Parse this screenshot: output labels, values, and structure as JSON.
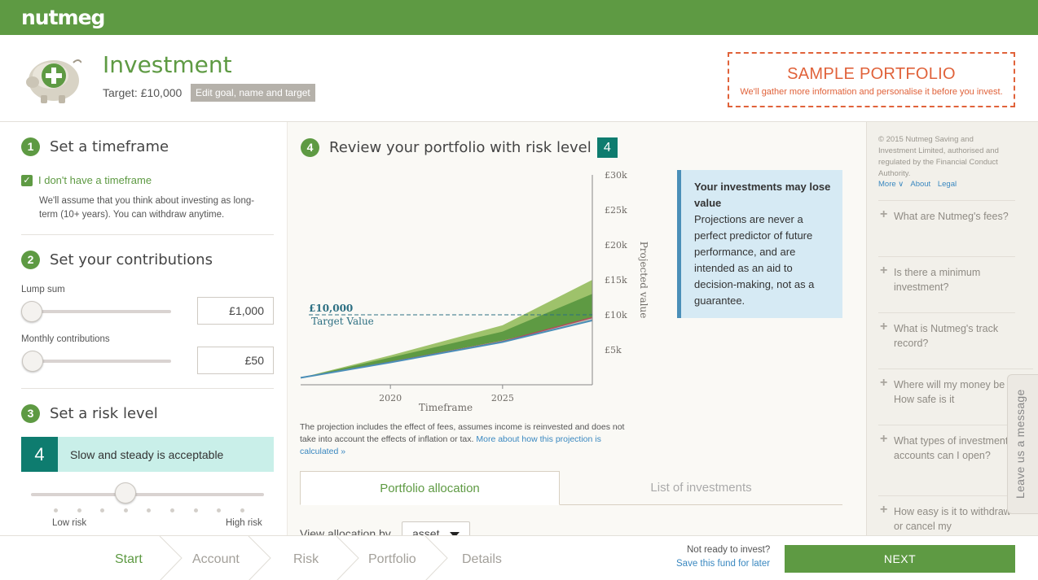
{
  "brand": {
    "logo": "nutmeg",
    "primary": "#5e9a43",
    "accent": "#0e7c6f",
    "warning": "#e0623a"
  },
  "header": {
    "title": "Investment",
    "target": "Target: £10,000",
    "edit_goal": "Edit goal, name and target",
    "sample_title": "SAMPLE PORTFOLIO",
    "sample_sub": "We'll gather more information and personalise it before you invest."
  },
  "steps": {
    "timeframe": {
      "num": "1",
      "title": "Set a timeframe",
      "checkbox_label": "I don't have a timeframe",
      "checked": true,
      "note": "We'll assume that you think about investing as long-term (10+ years). You can withdraw anytime."
    },
    "contributions": {
      "num": "2",
      "title": "Set your contributions",
      "lump_label": "Lump sum",
      "lump_value": "£1,000",
      "monthly_label": "Monthly contributions",
      "monthly_value": "£50"
    },
    "risk": {
      "num": "3",
      "title": "Set a risk level",
      "level": "4",
      "description": "Slow and steady is acceptable",
      "low": "Low risk",
      "high": "High risk",
      "level_index": 4,
      "level_count": 10
    }
  },
  "review": {
    "num": "4",
    "title": "Review your portfolio with risk level",
    "risk_level": "4",
    "warning_title": "Your investments may lose value",
    "warning_body": "Projections are never a perfect predictor of future performance, and are intended as an aid to decision-making, not as a guarantee.",
    "disclaimer": "The projection includes the effect of fees, assumes income is reinvested and does not take into account the effects of inflation or tax.",
    "disclaimer_link": "More about how this projection is calculated »",
    "tabs": [
      "Portfolio allocation",
      "List of investments"
    ],
    "view_by_label": "View allocation by",
    "view_by_value": "asset"
  },
  "chart_data": {
    "type": "area",
    "xlabel": "Timeframe",
    "ylabel": "Projected value",
    "x_ticks": [
      "2020",
      "2025"
    ],
    "y_ticks": [
      "£5k",
      "£10k",
      "£15k",
      "£20k",
      "£25k",
      "£30k"
    ],
    "ylim": [
      0,
      30000
    ],
    "xlim": [
      2016,
      2029
    ],
    "target": {
      "value": 10000,
      "label": "£10,000",
      "sublabel": "Target Value"
    },
    "series": [
      {
        "x": [
          2016,
          2020,
          2025,
          2029
        ],
        "values": [
          1000,
          4200,
          8500,
          15000
        ],
        "color": "#9ec26b"
      },
      {
        "x": [
          2016,
          2020,
          2025,
          2029
        ],
        "values": [
          1000,
          3900,
          7600,
          13000
        ],
        "color": "#5e9a43"
      },
      {
        "x": [
          2016,
          2020,
          2025,
          2029
        ],
        "values": [
          1000,
          3300,
          6300,
          9500
        ],
        "color": "#c4bfb3"
      },
      {
        "x": [
          2016,
          2020,
          2025,
          2029
        ],
        "values": [
          1000,
          3200,
          6100,
          9200
        ],
        "color": "#4a8fb8"
      },
      {
        "x": [
          2016,
          2020,
          2025,
          2029
        ],
        "values": [
          1000,
          3250,
          6200,
          9600
        ],
        "color": "#b34a5e"
      }
    ]
  },
  "sidebar": {
    "copyright": "© 2015 Nutmeg Saving and Investment Limited, authorised and regulated by the Financial Conduct Authority.",
    "links": [
      "More ∨",
      "About",
      "Legal"
    ],
    "faqs": [
      "What are Nutmeg's fees?",
      "Is there a minimum investment?",
      "What is Nutmeg's track record?",
      "Where will my money be held? How safe is it",
      "What types of investment accounts can I open?",
      "How easy is it to withdraw or cancel my"
    ],
    "leave_message": "Leave us a message"
  },
  "footer": {
    "crumbs": [
      "Start",
      "Account",
      "Risk",
      "Portfolio",
      "Details"
    ],
    "not_ready": "Not ready to invest?",
    "save_later": "Save this fund for later",
    "next": "NEXT"
  }
}
